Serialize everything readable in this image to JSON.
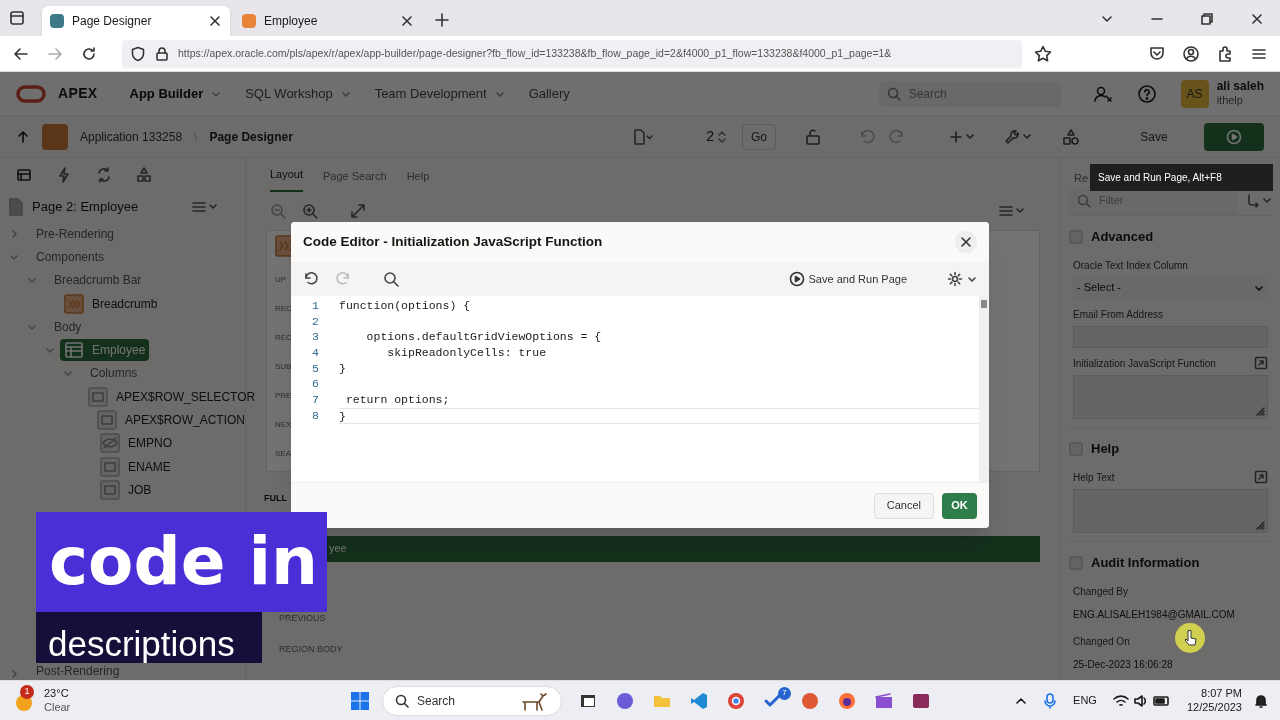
{
  "browser": {
    "tabs": [
      {
        "label": "Page Designer",
        "selected": true
      },
      {
        "label": "Employee",
        "selected": false
      }
    ],
    "url": "https://apex.oracle.com/pls/apex/r/apex/app-builder/page-designer?fb_flow_id=133238&fb_flow_page_id=2&f4000_p1_flow=133238&f4000_p1_page=1&"
  },
  "app_header": {
    "logo": "APEX",
    "nav": [
      {
        "label": "App Builder",
        "selected": true
      },
      {
        "label": "SQL Workshop",
        "selected": false
      },
      {
        "label": "Team Development",
        "selected": false
      },
      {
        "label": "Gallery",
        "selected": false
      }
    ],
    "search": {
      "placeholder": "Search"
    },
    "user": {
      "initials": "AS",
      "name": "ali saleh",
      "workspace": "ithelp"
    }
  },
  "toolbar": {
    "breadcrumb": [
      "Application 133258",
      "Page Designer"
    ],
    "breadcrumb_separator": "\\",
    "page_number": "2",
    "go": "Go",
    "save": "Save"
  },
  "left_panel": {
    "page_title": "Page 2: Employee",
    "tree": [
      {
        "label": "Pre-Rendering",
        "kind": "group",
        "expanded": false,
        "selected": false
      },
      {
        "label": "Components",
        "kind": "group",
        "expanded": true,
        "selected": false,
        "children": [
          {
            "label": "Breadcrumb Bar",
            "kind": "group",
            "expanded": true,
            "selected": false,
            "children": [
              {
                "label": "Breadcrumb",
                "kind": "breadcrumb",
                "selected": false
              }
            ]
          },
          {
            "label": "Body",
            "kind": "group",
            "expanded": true,
            "selected": false,
            "children": [
              {
                "label": "Employee",
                "kind": "grid",
                "expanded": true,
                "selected": true,
                "children": [
                  {
                    "label": "Columns",
                    "kind": "group",
                    "expanded": true,
                    "selected": false,
                    "children": [
                      {
                        "label": "APEX$ROW_SELECTOR",
                        "kind": "column",
                        "selected": false
                      },
                      {
                        "label": "APEX$ROW_ACTION",
                        "kind": "column",
                        "selected": false
                      },
                      {
                        "label": "EMPNO",
                        "kind": "hidden",
                        "selected": false
                      },
                      {
                        "label": "ENAME",
                        "kind": "column",
                        "selected": false
                      },
                      {
                        "label": "JOB",
                        "kind": "column",
                        "selected": false
                      }
                    ]
                  }
                ]
              }
            ]
          }
        ]
      },
      {
        "label": "Post-Rendering",
        "kind": "group",
        "expanded": false,
        "selected": false
      }
    ]
  },
  "center": {
    "tabs": [
      {
        "label": "Layout",
        "selected": true
      },
      {
        "label": "Page Search",
        "selected": false
      },
      {
        "label": "Help",
        "selected": false
      }
    ],
    "region_labels": [
      "UP",
      "REC",
      "REC",
      "SUB",
      "PRE",
      "NEX",
      "SEA"
    ],
    "full_width_label": "FULL",
    "region_bar": "yee",
    "lower_labels": [
      "PREVIOUS",
      "REGION BODY"
    ]
  },
  "dialog": {
    "title": "Code Editor - Initialization JavaScript Function",
    "save_run": "Save and Run Page",
    "code": [
      {
        "number": "1",
        "text": "function(options) {"
      },
      {
        "number": "2"
      },
      {
        "number": "3",
        "text": "    options.defaultGridViewOptions = {"
      },
      {
        "number": "4",
        "text": "       skipReadonlyCells: true"
      },
      {
        "number": "5",
        "text": "}"
      },
      {
        "number": "6"
      },
      {
        "number": "7",
        "text": " return options;"
      },
      {
        "number": "8",
        "text": "}"
      }
    ],
    "cancel": "Cancel",
    "ok": "OK"
  },
  "tooltip": "Save and Run Page, Alt+F8",
  "right_panel": {
    "tab": "Re",
    "filter_placeholder": "Filter",
    "sections": [
      {
        "title": "Advanced",
        "fields": [
          {
            "label": "Oracle Text Index Column",
            "kind": "select",
            "value": "- Select -"
          },
          {
            "label": "Email From Address",
            "kind": "text"
          },
          {
            "label": "Initialization JavaScript Function",
            "kind": "code"
          }
        ]
      },
      {
        "title": "Help",
        "fields": [
          {
            "label": "Help Text",
            "kind": "code"
          }
        ]
      },
      {
        "title": "Audit Information",
        "fields": [
          {
            "label": "Changed By",
            "kind": "display",
            "value": "ENG.ALISALEH1984@GMAIL.COM"
          },
          {
            "label": "Changed On",
            "kind": "display",
            "value": "25-Dec-2023 16:06:28"
          }
        ]
      }
    ]
  },
  "overlay_banner": {
    "line_1": "code in",
    "line_2": "descriptions"
  },
  "taskbar": {
    "weather": {
      "badge": "1",
      "temp": "23°C",
      "condition": "Clear"
    },
    "search_placeholder": "Search",
    "app_badge": "7",
    "language": "ENG",
    "time": "8:07 PM",
    "date": "12/25/2023"
  }
}
